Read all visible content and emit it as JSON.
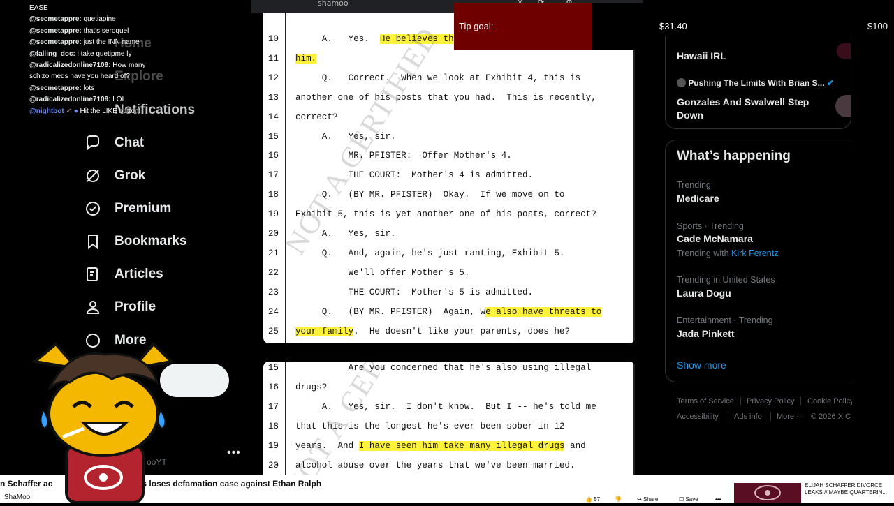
{
  "browser": {
    "tab_title": "shamoo"
  },
  "chat": {
    "messages": [
      {
        "user": "",
        "text": "EASE",
        "bot": false
      },
      {
        "user": "@secmetappre:",
        "text": "quetiapine",
        "bot": false
      },
      {
        "user": "@secmetappre:",
        "text": "that's seroquel",
        "bot": false
      },
      {
        "user": "@secmetappre:",
        "text": "just the INN name",
        "bot": false
      },
      {
        "user": "@falling_doc:",
        "text": "i take quetipme ly",
        "bot": false
      },
      {
        "user": "@radicalizedonline7109:",
        "text": "How many",
        "bot": false
      },
      {
        "user": "",
        "text": "schizo meds have you heard of?",
        "bot": false
      },
      {
        "user": "@secmetappre:",
        "text": "lots",
        "bot": false
      },
      {
        "user": "@radicalizedonline7109:",
        "text": "LOL",
        "bot": false
      },
      {
        "user": "@nightbot",
        "text": "Hit the LIKE button!",
        "bot": true
      }
    ],
    "ghost": {
      "home": "Home",
      "explore": "Explore",
      "notifications": "Notifications"
    }
  },
  "nav": {
    "items": [
      {
        "label": "Chat",
        "icon": "chat-icon"
      },
      {
        "label": "Grok",
        "icon": "grok-icon"
      },
      {
        "label": "Premium",
        "icon": "premium-icon"
      },
      {
        "label": "Bookmarks",
        "icon": "bookmark-icon"
      },
      {
        "label": "Articles",
        "icon": "articles-icon"
      },
      {
        "label": "Profile",
        "icon": "profile-icon"
      },
      {
        "label": "More",
        "icon": "more-icon"
      }
    ],
    "handle_fragment": "ooYT",
    "more_dots": "•••"
  },
  "document": {
    "watermark": "NOT A CERTIFIED",
    "page1": [
      {
        "n": "10",
        "pre": "     A.   Yes.  ",
        "hl": "He believes the",
        "post": ""
      },
      {
        "n": "11",
        "pre": "",
        "hl": "him.",
        "post": ""
      },
      {
        "n": "12",
        "pre": "     Q.   Correct.  When we look at Exhibit 4, this is",
        "hl": "",
        "post": ""
      },
      {
        "n": "13",
        "pre": "another one of his posts that you had.  This is recently,",
        "hl": "",
        "post": ""
      },
      {
        "n": "14",
        "pre": "correct?",
        "hl": "",
        "post": ""
      },
      {
        "n": "15",
        "pre": "     A.   Yes, sir.",
        "hl": "",
        "post": ""
      },
      {
        "n": "16",
        "pre": "          MR. PFISTER:  Offer Mother's 4.",
        "hl": "",
        "post": ""
      },
      {
        "n": "17",
        "pre": "          THE COURT:  Mother's 4 is admitted.",
        "hl": "",
        "post": ""
      },
      {
        "n": "18",
        "pre": "     Q.   (BY MR. PFISTER)  Okay.  If we move on to",
        "hl": "",
        "post": ""
      },
      {
        "n": "19",
        "pre": "Exhibit 5, this is yet another one of his posts, correct?",
        "hl": "",
        "post": ""
      },
      {
        "n": "20",
        "pre": "     A.   Yes, sir.",
        "hl": "",
        "post": ""
      },
      {
        "n": "21",
        "pre": "     Q.   And, again, he's just ranting, Exhibit 5.",
        "hl": "",
        "post": ""
      },
      {
        "n": "22",
        "pre": "          We'll offer Mother's 5.",
        "hl": "",
        "post": ""
      },
      {
        "n": "23",
        "pre": "          THE COURT:  Mother's 5 is admitted.",
        "hl": "",
        "post": ""
      },
      {
        "n": "24",
        "pre": "     Q.   (BY MR. PFISTER)  Again, w",
        "hl": "e also have threats to",
        "post": ""
      },
      {
        "n": "25",
        "pre": "",
        "hl": "your family",
        "post": ".  He doesn't like your parents, does he?"
      }
    ],
    "page2": [
      {
        "n": "15",
        "pre": "          Are you concerned that he's also using illegal",
        "hl": "",
        "post": ""
      },
      {
        "n": "16",
        "pre": "drugs?",
        "hl": "",
        "post": ""
      },
      {
        "n": "17",
        "pre": "     A.   Yes, sir.  I don't know.  But I -- he's told me",
        "hl": "",
        "post": ""
      },
      {
        "n": "18",
        "pre": "that this is the longest he's ever been sober in 12",
        "hl": "",
        "post": ""
      },
      {
        "n": "19",
        "pre": "years.  And ",
        "hl": "I have seen him take many illegal drugs",
        "post": " and"
      },
      {
        "n": "20",
        "pre": "alcohol abuse over the years that we've been married.",
        "hl": "",
        "post": ""
      }
    ]
  },
  "tip_goal": {
    "label": "Tip goal:",
    "current": "$31.40",
    "target": "$100",
    "progress": 0.314,
    "fill_color": "#6e0000"
  },
  "right": {
    "top_items": [
      {
        "title": "Hawaii IRL"
      },
      {
        "source": "Pushing The Limits With Brian S...",
        "title": "Gonzales And Swalwell Step Down"
      }
    ],
    "whats_happening": {
      "heading": "What’s happening",
      "trends": [
        {
          "meta": "Trending",
          "title": "Medicare",
          "with_label": "",
          "with_link": ""
        },
        {
          "meta": "Sports · Trending",
          "title": "Cade McNamara",
          "with_label": "Trending with",
          "with_link": "Kirk Ferentz"
        },
        {
          "meta": "Trending in United States",
          "title": "Laura Dogu",
          "with_label": "",
          "with_link": ""
        },
        {
          "meta": "Entertainment · Trending",
          "title": "Jada Pinkett",
          "with_label": "",
          "with_link": ""
        }
      ],
      "show_more": "Show more"
    },
    "footer": {
      "terms": "Terms of Service",
      "privacy": "Privacy Policy",
      "cookie": "Cookie Policy",
      "accessibility": "Accessibility",
      "ads": "Ads info",
      "more": "More ···",
      "copyright": "© 2026 X C"
    }
  },
  "youtube": {
    "title": "n Schaffer ac                                   ers loses defamation case against Ethan Ralph",
    "channel": "ShaMoo",
    "likes": "57",
    "share": "Share",
    "save": "Save",
    "next_title": "ELIJAH SCHAFFER DIVORCE LEAKS // MAYBE QUARTERIN..."
  }
}
